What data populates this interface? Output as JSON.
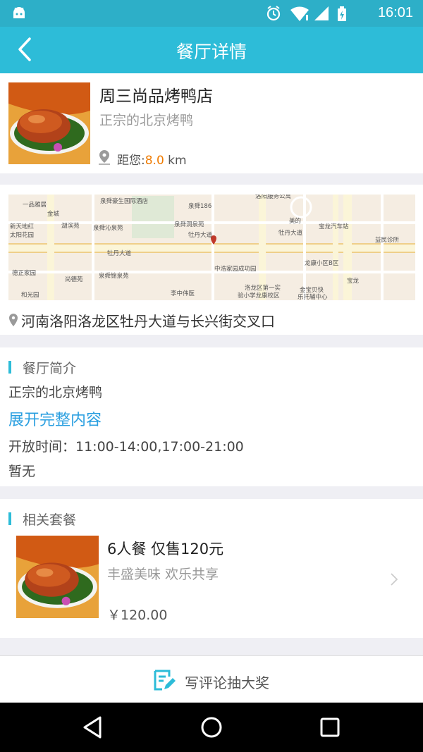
{
  "status": {
    "time": "16:01"
  },
  "header": {
    "title": "餐厅详情"
  },
  "shop": {
    "name": "周三尚品烤鸭店",
    "slogan": "正宗的北京烤鸭",
    "distance_label": "距您:",
    "distance_value": "8.0",
    "distance_unit": " km"
  },
  "map": {
    "address": "河南洛阳洛龙区牡丹大道与长兴街交叉口",
    "labels": [
      "一品雅居",
      "泉舜豪生国际酒店",
      "泉舜186",
      "洛阳服务公寓",
      "新天地红",
      "太阳花园",
      "金城",
      "湖滨苑",
      "泉舜沁泉苑",
      "泉舜洞泉苑",
      "美的",
      "宝龙汽车站",
      "益民诊所",
      "牡丹大道",
      "牡丹大道",
      "牡丹大道",
      "德正家园",
      "尚德苑",
      "泉舜锦泉苑",
      "中浩家园成功园",
      "龙康小区B区",
      "和光园",
      "李中伟医",
      "洛龙区第一实",
      "验小学龙康校区",
      "金宝贝快",
      "乐托辅中心",
      "宝龙"
    ]
  },
  "intro": {
    "section_title": "餐厅简介",
    "desc": "正宗的北京烤鸭",
    "expand": "展开完整内容",
    "hours": "开放时间：11:00-14:00,17:00-21:00",
    "note": "暂无"
  },
  "combo": {
    "section_title": "相关套餐",
    "name": "6人餐 仅售120元",
    "subtitle": "丰盛美味 欢乐共享",
    "price": "￥120.00"
  },
  "review": {
    "label": "写评论抽大奖"
  },
  "colors": {
    "primary": "#2dbcd8",
    "accent_orange": "#f07b00",
    "link_blue": "#2a9fe0"
  }
}
